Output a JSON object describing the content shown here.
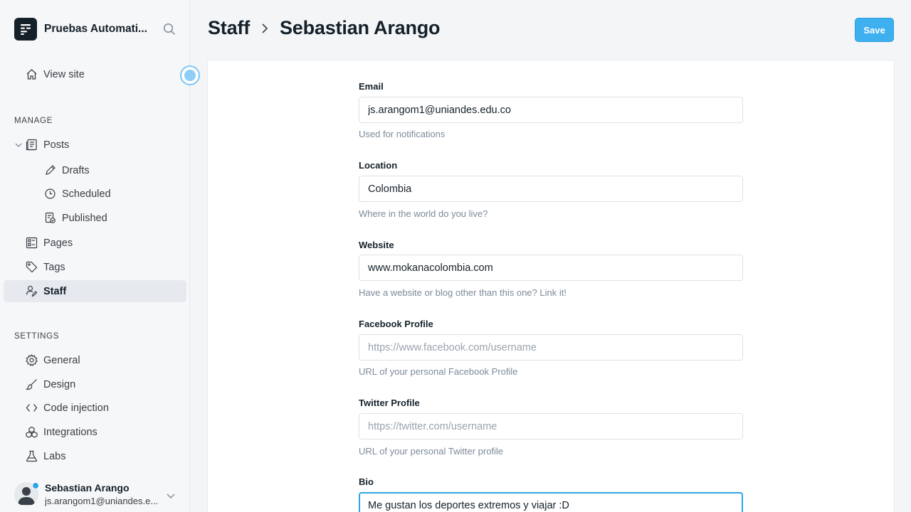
{
  "sidebar": {
    "brand_title": "Pruebas Automati...",
    "view_site": "View site",
    "manage_title": "MANAGE",
    "posts": "Posts",
    "drafts": "Drafts",
    "scheduled": "Scheduled",
    "published": "Published",
    "pages": "Pages",
    "tags": "Tags",
    "staff": "Staff",
    "settings_title": "SETTINGS",
    "general": "General",
    "design": "Design",
    "code_injection": "Code injection",
    "integrations": "Integrations",
    "labs": "Labs",
    "user": {
      "name": "Sebastian Arango",
      "email": "js.arangom1@uniandes.e..."
    }
  },
  "header": {
    "crumb_parent": "Staff",
    "crumb_current": "Sebastian Arango",
    "save_label": "Save"
  },
  "form": {
    "email": {
      "label": "Email",
      "value": "js.arangom1@uniandes.edu.co",
      "help": "Used for notifications"
    },
    "location": {
      "label": "Location",
      "value": "Colombia",
      "help": "Where in the world do you live?"
    },
    "website": {
      "label": "Website",
      "value": "www.mokanacolombia.com",
      "help": "Have a website or blog other than this one? Link it!"
    },
    "facebook": {
      "label": "Facebook Profile",
      "value": "",
      "placeholder": "https://www.facebook.com/username",
      "help": "URL of your personal Facebook Profile"
    },
    "twitter": {
      "label": "Twitter Profile",
      "value": "",
      "placeholder": "https://twitter.com/username",
      "help": "URL of your personal Twitter profile"
    },
    "bio": {
      "label": "Bio",
      "value": "Me gustan los deportes extremos y viajar :D"
    }
  },
  "colors": {
    "accent": "#3eb0ef",
    "sidebar_active": "#e6e9ee",
    "focus_border": "#30a4e6"
  }
}
